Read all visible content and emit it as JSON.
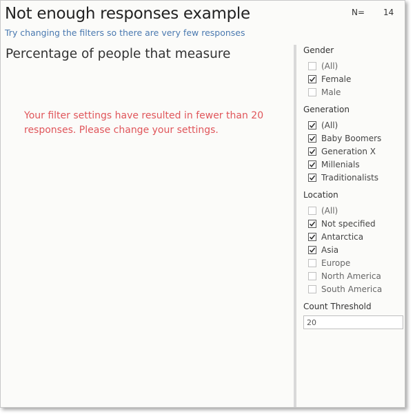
{
  "header": {
    "title": "Not enough responses example",
    "subtitle": "Try changing the filters so there are very few responses",
    "n_label": "N=",
    "n_value": "14"
  },
  "sheet": {
    "title": "Percentage of people that measure",
    "warning": "Your filter settings have resulted in fewer than 20 responses. Please change your settings."
  },
  "filters": {
    "gender": {
      "title": "Gender",
      "options": [
        {
          "label": "(All)",
          "checked": false
        },
        {
          "label": "Female",
          "checked": true
        },
        {
          "label": "Male",
          "checked": false
        }
      ]
    },
    "generation": {
      "title": "Generation",
      "options": [
        {
          "label": "(All)",
          "checked": true
        },
        {
          "label": "Baby Boomers",
          "checked": true
        },
        {
          "label": "Generation X",
          "checked": true
        },
        {
          "label": "Millenials",
          "checked": true
        },
        {
          "label": "Traditionalists",
          "checked": true
        }
      ]
    },
    "location": {
      "title": "Location",
      "options": [
        {
          "label": "(All)",
          "checked": false
        },
        {
          "label": "Not specified",
          "checked": true
        },
        {
          "label": "Antarctica",
          "checked": true
        },
        {
          "label": "Asia",
          "checked": true
        },
        {
          "label": "Europe",
          "checked": false
        },
        {
          "label": "North America",
          "checked": false
        },
        {
          "label": "South America",
          "checked": false
        }
      ]
    },
    "count_threshold": {
      "title": "Count Threshold",
      "value": "20"
    }
  },
  "colors": {
    "title_text": "#222222",
    "subtitle_text": "#4a79b0",
    "warning_text": "#e0555a",
    "background": "#fbfbf9"
  }
}
